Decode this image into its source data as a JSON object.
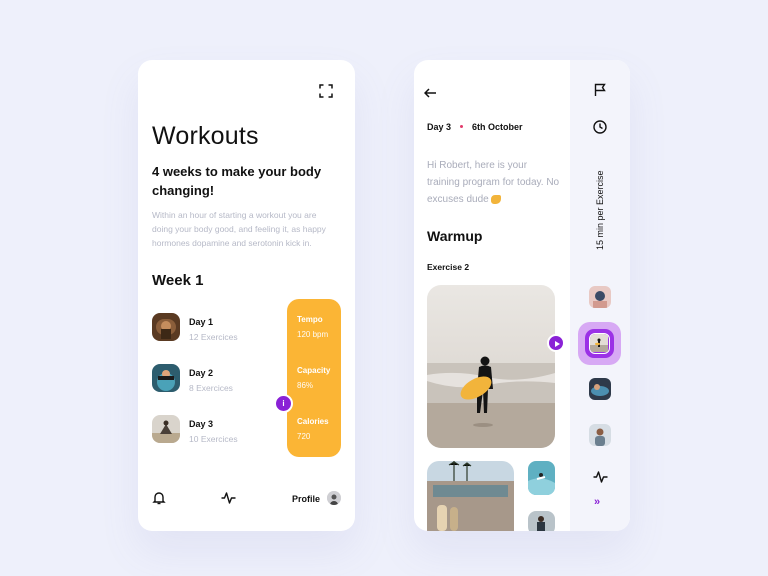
{
  "workouts": {
    "title": "Workouts",
    "subtitle": "4 weeks to make your body changing!",
    "description": "Within an hour of starting a workout you are doing your body good, and feeling it, as happy hormones dopamine and serotonin kick in.",
    "week_label": "Week 1",
    "days": [
      {
        "name": "Day 1",
        "count": "12 Exercices"
      },
      {
        "name": "Day 2",
        "count": "8 Exercices"
      },
      {
        "name": "Day 3",
        "count": "10 Exercices"
      }
    ],
    "stats": [
      {
        "label": "Tempo",
        "value": "120 bpm"
      },
      {
        "label": "Capacity",
        "value": "86%"
      },
      {
        "label": "Calories",
        "value": "720"
      }
    ],
    "info_glyph": "i",
    "nav": {
      "profile_label": "Profile",
      "icons": [
        "bell-icon",
        "pulse-icon"
      ]
    },
    "colors": {
      "accent": "#8a21d6",
      "stats_bg": "#fbb535"
    }
  },
  "program": {
    "day": "Day 3",
    "date": "6th October",
    "greeting": "Hi Robert, here is your training program for today. No excuses dude",
    "section_title": "Warmup",
    "exercise_label": "Exercise 2",
    "side_label": "15 min per Exercise",
    "chevron": "»",
    "icons": [
      "back-arrow-icon",
      "flag-icon",
      "clock-icon",
      "play-icon",
      "pulse-icon"
    ]
  }
}
